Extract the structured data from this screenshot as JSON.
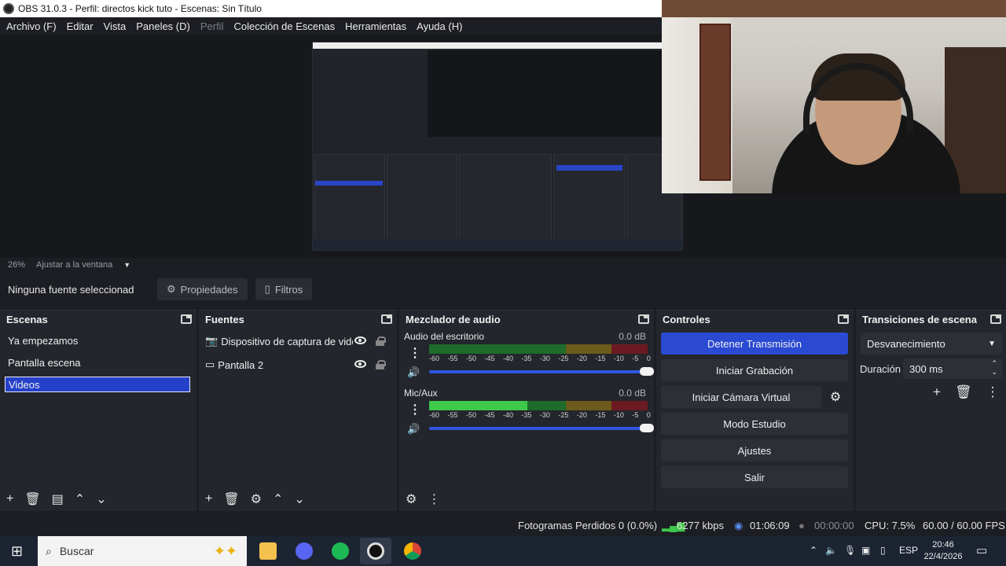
{
  "window": {
    "title": "OBS 31.0.3 - Perfil: directos kick tuto - Escenas: Sin Título"
  },
  "menu": [
    {
      "label": "Archivo (F)",
      "disabled": false
    },
    {
      "label": "Editar",
      "disabled": false
    },
    {
      "label": "Vista",
      "disabled": false
    },
    {
      "label": "Paneles (D)",
      "disabled": false
    },
    {
      "label": "Perfil",
      "disabled": true
    },
    {
      "label": "Colección de Escenas",
      "disabled": false
    },
    {
      "label": "Herramientas",
      "disabled": false
    },
    {
      "label": "Ayuda (H)",
      "disabled": false
    }
  ],
  "zoom": {
    "percent": "26%",
    "fit_label": "Ajustar a la ventana"
  },
  "source_toolbar": {
    "no_selection": "Ninguna fuente seleccionad",
    "properties": "Propiedades",
    "filters": "Filtros"
  },
  "scenes": {
    "title": "Escenas",
    "items": [
      "Ya empezamos",
      "Pantalla escena",
      "Videos"
    ],
    "selected_index": 2
  },
  "sources": {
    "title": "Fuentes",
    "items": [
      {
        "label": "Dispositivo de captura de vide",
        "icon": "camera-icon"
      },
      {
        "label": "Pantalla 2",
        "icon": "monitor-icon"
      }
    ]
  },
  "mixer": {
    "title": "Mezclador de audio",
    "ticks": [
      "-60",
      "-55",
      "-50",
      "-45",
      "-40",
      "-35",
      "-30",
      "-25",
      "-20",
      "-15",
      "-10",
      "-5",
      "0"
    ],
    "channels": [
      {
        "name": "Audio del escritorio",
        "db": "0.0 dB",
        "level": 0.0,
        "volume": 1.0
      },
      {
        "name": "Mic/Aux",
        "db": "0.0 dB",
        "level": 0.45,
        "volume": 1.0
      }
    ]
  },
  "controls": {
    "title": "Controles",
    "stop_stream": "Detener Transmisión",
    "start_recording": "Iniciar Grabación",
    "start_virtual_cam": "Iniciar Cámara Virtual",
    "studio_mode": "Modo Estudio",
    "settings": "Ajustes",
    "exit": "Salir"
  },
  "transitions": {
    "title": "Transiciones de escena",
    "selected": "Desvanecimiento",
    "duration_label": "Duración",
    "duration_value": "300 ms"
  },
  "status": {
    "dropped_frames": "Fotogramas Perdidos 0 (0.0%)",
    "bitrate": "6277 kbps",
    "stream_time": "01:06:09",
    "record_time": "00:00:00",
    "cpu": "CPU: 7.5%",
    "fps": "60.00 / 60.00 FPS"
  },
  "taskbar": {
    "search_placeholder": "Buscar",
    "lang": "ESP",
    "time": "20:46",
    "date": "22/4/2026"
  },
  "colors": {
    "accent": "#2b4ad3",
    "meter_green": "#3fc84a",
    "dock_bg": "#23262c"
  }
}
